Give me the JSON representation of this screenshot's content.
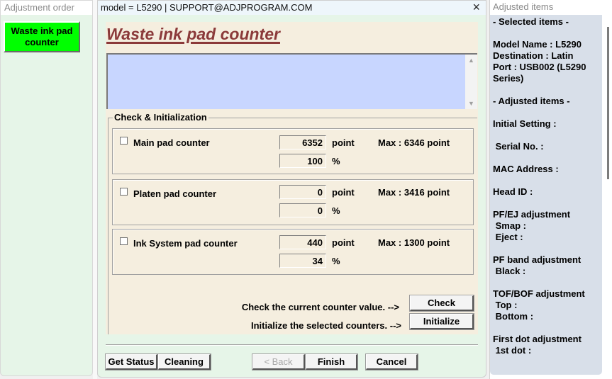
{
  "left_panel": {
    "header": "Adjustment order",
    "items": [
      {
        "label": "Waste ink pad\ncounter",
        "color": "#00ff00"
      }
    ]
  },
  "dialog": {
    "title": "model = L5290 | SUPPORT@ADJPROGRAM.COM",
    "close_icon": "×",
    "heading": "Waste ink pad counter",
    "log_text": "",
    "group_label": "Check & Initialization",
    "counters": [
      {
        "label": "Main pad counter",
        "checked": false,
        "point": "6352",
        "percent": "100",
        "point_unit": "point",
        "percent_unit": "%",
        "max": "Max : 6346 point"
      },
      {
        "label": "Platen pad counter",
        "checked": false,
        "point": "0",
        "percent": "0",
        "point_unit": "point",
        "percent_unit": "%",
        "max": "Max : 3416 point"
      },
      {
        "label": "Ink System pad counter",
        "checked": false,
        "point": "440",
        "percent": "34",
        "point_unit": "point",
        "percent_unit": "%",
        "max": "Max : 1300 point"
      }
    ],
    "check_hint": "Check the current counter value. -->",
    "check_label": "Check",
    "init_hint": "Initialize the selected counters. -->",
    "init_label": "Initialize",
    "footer": {
      "get_status": "Get Status",
      "cleaning": "Cleaning",
      "back": "< Back",
      "finish": "Finish",
      "cancel": "Cancel"
    }
  },
  "right_panel": {
    "header": "Adjusted items",
    "selected_header": "- Selected items -",
    "model_name": "Model Name : L5290",
    "destination": "Destination : Latin",
    "port": "Port : USB002 (L5290\nSeries)",
    "adjusted_header": "- Adjusted items -",
    "initial_setting": "Initial Setting :",
    "serial_no": " Serial No. :",
    "mac_address": "MAC Address :",
    "head_id": "Head ID :",
    "pfej": "PF/EJ adjustment\n Smap :\n Eject :",
    "pf_band": "PF band adjustment\n Black :",
    "tofbof": "TOF/BOF adjustment\n Top :\n Bottom :",
    "first_dot": "First dot adjustment\n 1st dot :"
  }
}
